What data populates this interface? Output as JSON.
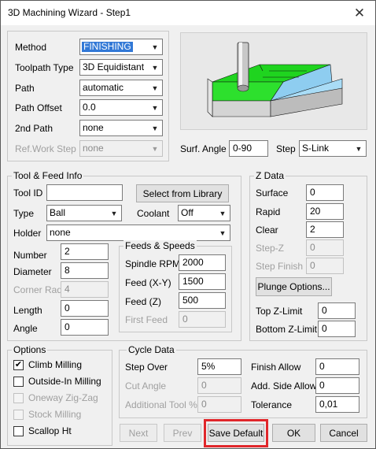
{
  "window": {
    "title": "3D Machining Wizard - Step1"
  },
  "method_panel": {
    "method": {
      "label": "Method",
      "value": "FINISHING"
    },
    "toolpath_type": {
      "label": "Toolpath Type",
      "value": "3D Equidistant"
    },
    "path": {
      "label": "Path",
      "value": "automatic"
    },
    "path_offset": {
      "label": "Path Offset",
      "value": "0.0"
    },
    "second_path": {
      "label": "2nd Path",
      "value": "none"
    },
    "ref_work_step": {
      "label": "Ref.Work Step",
      "value": "none"
    }
  },
  "preview": {
    "surf_angle": {
      "label": "Surf. Angle",
      "value": "0-90"
    },
    "step": {
      "label": "Step",
      "value": "S-Link"
    }
  },
  "tool_feed": {
    "title": "Tool & Feed Info",
    "tool_id": {
      "label": "Tool ID",
      "value": ""
    },
    "library_button": "Select from Library",
    "type": {
      "label": "Type",
      "value": "Ball"
    },
    "coolant": {
      "label": "Coolant",
      "value": "Off"
    },
    "holder": {
      "label": "Holder",
      "value": "none"
    },
    "number": {
      "label": "Number",
      "value": "2"
    },
    "diameter": {
      "label": "Diameter",
      "value": "8"
    },
    "corner_rad": {
      "label": "Corner Rad",
      "value": "4"
    },
    "length": {
      "label": "Length",
      "value": "0"
    },
    "angle": {
      "label": "Angle",
      "value": "0"
    },
    "feeds": {
      "title": "Feeds & Speeds",
      "spindle_rpm": {
        "label": "Spindle RPM",
        "value": "2000"
      },
      "feed_xy": {
        "label": "Feed (X-Y)",
        "value": "1500"
      },
      "feed_z": {
        "label": "Feed (Z)",
        "value": "500"
      },
      "first_feed": {
        "label": "First Feed",
        "value": "0"
      }
    }
  },
  "z_data": {
    "title": "Z Data",
    "surface": {
      "label": "Surface",
      "value": "0"
    },
    "rapid": {
      "label": "Rapid",
      "value": "20"
    },
    "clear": {
      "label": "Clear",
      "value": "2"
    },
    "step_z": {
      "label": "Step-Z",
      "value": "0"
    },
    "step_finish": {
      "label": "Step Finish",
      "value": "0"
    },
    "plunge_button": "Plunge Options...",
    "top_z_limit": {
      "label": "Top Z-Limit",
      "value": "0"
    },
    "bottom_z_limit": {
      "label": "Bottom Z-Limit",
      "value": "0"
    }
  },
  "options": {
    "title": "Options",
    "climb_milling": {
      "label": "Climb Milling",
      "checked": true
    },
    "outside_in": {
      "label": "Outside-In Milling",
      "checked": false
    },
    "oneway_zigzag": {
      "label": "Oneway Zig-Zag",
      "checked": false
    },
    "stock_milling": {
      "label": "Stock Milling",
      "checked": false
    },
    "scallop_ht": {
      "label": "Scallop Ht",
      "checked": false
    }
  },
  "cycle_data": {
    "title": "Cycle Data",
    "step_over": {
      "label": "Step Over",
      "value": "5%"
    },
    "cut_angle": {
      "label": "Cut Angle",
      "value": "0"
    },
    "additional_tool": {
      "label": "Additional Tool %",
      "value": "0"
    },
    "finish_allow": {
      "label": "Finish Allow",
      "value": "0"
    },
    "add_side_allow": {
      "label": "Add. Side Allow",
      "value": "0"
    },
    "tolerance": {
      "label": "Tolerance",
      "value": "0,01"
    }
  },
  "buttons": {
    "next": "Next",
    "prev": "Prev",
    "save_default": "Save Default",
    "ok": "OK",
    "cancel": "Cancel"
  },
  "colors": {
    "highlight": "#e0262a",
    "selection": "#3178d6",
    "surface_green": "#22dd22",
    "surface_blue": "#8ecdf0"
  }
}
